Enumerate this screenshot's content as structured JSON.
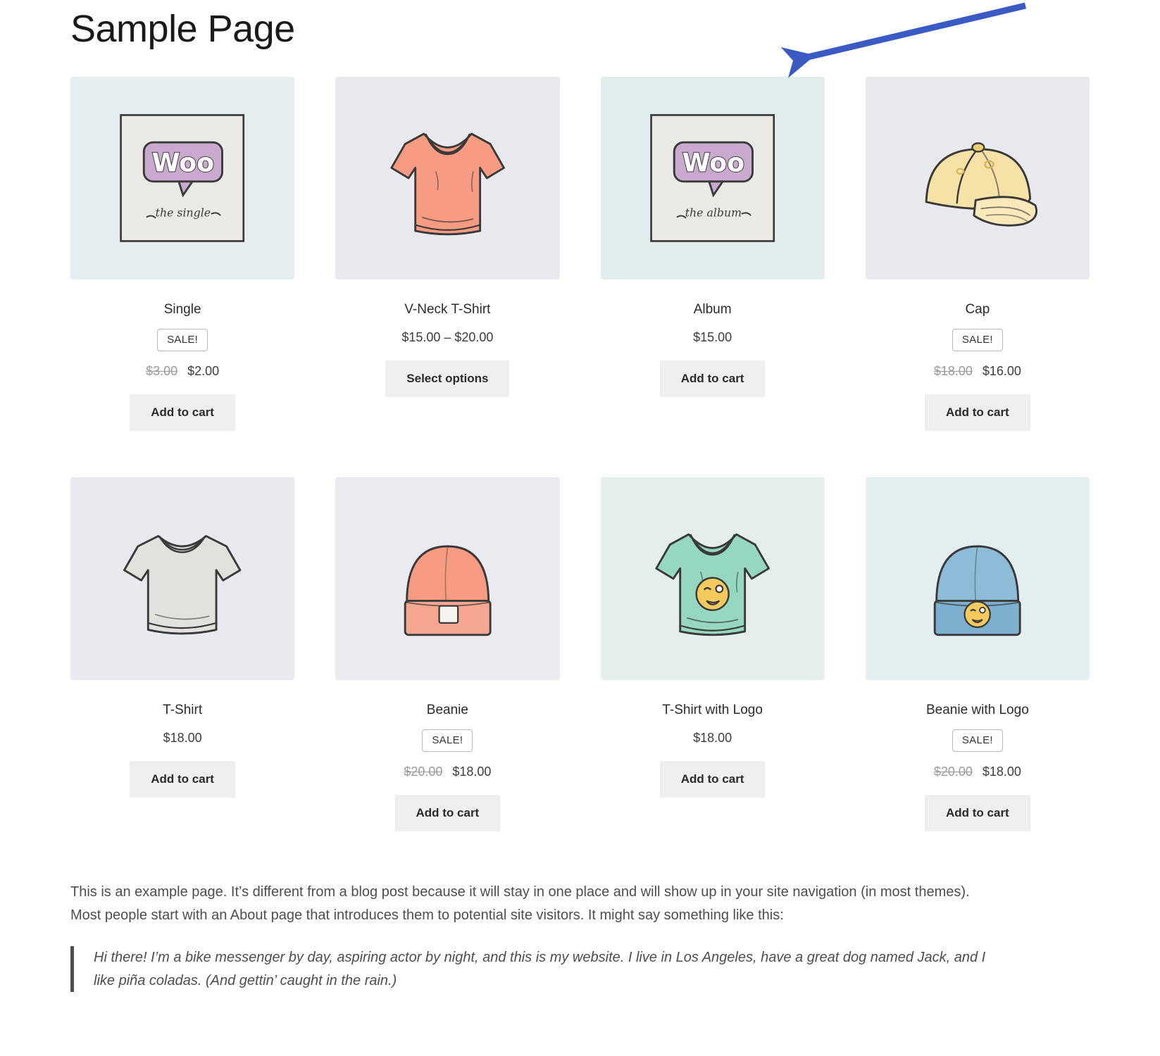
{
  "page": {
    "title": "Sample Page"
  },
  "annotation": {
    "arrow_color": "#3a5bc4",
    "arrow_name": "blue-annotation-arrow",
    "points_to": "Album"
  },
  "labels": {
    "sale_badge": "SALE!",
    "add_to_cart": "Add to cart",
    "select_options": "Select options"
  },
  "products": [
    {
      "name": "Single",
      "on_sale": true,
      "sale_label": "SALE!",
      "price_old": "$3.00",
      "price": "$2.00",
      "button": "Add to cart",
      "tile_color": "#e4eef0",
      "art": "album-single"
    },
    {
      "name": "V-Neck T-Shirt",
      "on_sale": false,
      "price": "$15.00 – $20.00",
      "button": "Select options",
      "tile_color": "#e8eaf0",
      "art": "vneck-tshirt-coral"
    },
    {
      "name": "Album",
      "on_sale": false,
      "price": "$15.00",
      "button": "Add to cart",
      "tile_color": "#e2edee",
      "art": "album-cover"
    },
    {
      "name": "Cap",
      "on_sale": true,
      "sale_label": "SALE!",
      "price_old": "$18.00",
      "price": "$16.00",
      "button": "Add to cart",
      "tile_color": "#e8eaf0",
      "art": "cap-yellow"
    },
    {
      "name": "T-Shirt",
      "on_sale": false,
      "price": "$18.00",
      "button": "Add to cart",
      "tile_color": "#e8eaf0",
      "art": "tshirt-grey"
    },
    {
      "name": "Beanie",
      "on_sale": true,
      "sale_label": "SALE!",
      "price_old": "$20.00",
      "price": "$18.00",
      "button": "Add to cart",
      "tile_color": "#e9ebf0",
      "art": "beanie-coral"
    },
    {
      "name": "T-Shirt with Logo",
      "on_sale": false,
      "price": "$18.00",
      "button": "Add to cart",
      "tile_color": "#e3eeed",
      "art": "tshirt-mint-logo"
    },
    {
      "name": "Beanie with Logo",
      "on_sale": true,
      "sale_label": "SALE!",
      "price_old": "$20.00",
      "price": "$18.00",
      "button": "Add to cart",
      "tile_color": "#e3eef1",
      "art": "beanie-blue-logo"
    }
  ],
  "content": {
    "paragraph": "This is an example page. It’s different from a blog post because it will stay in one place and will show up in your site navigation (in most themes). Most people start with an About page that introduces them to potential site visitors. It might say something like this:",
    "blockquote": "Hi there! I’m a bike messenger by day, aspiring actor by night, and this is my website. I live in Los Angeles, have a great dog named Jack, and I like piña coladas. (And gettin’ caught in the rain.)"
  }
}
